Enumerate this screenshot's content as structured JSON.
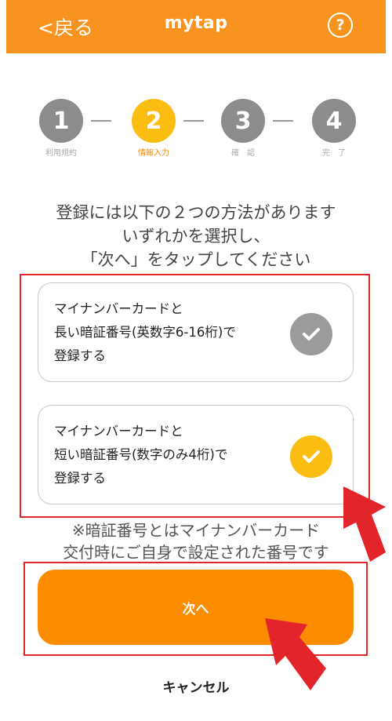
{
  "header": {
    "back_label": "<戻る",
    "title": "mytap",
    "help_label": "?"
  },
  "stepper": {
    "steps": [
      {
        "number": "1",
        "label": "利用規約"
      },
      {
        "number": "2",
        "label": "情報入力"
      },
      {
        "number": "3",
        "label": "確　認"
      },
      {
        "number": "4",
        "label": "完　了"
      }
    ],
    "active_step": 2
  },
  "instructions": {
    "line1": "登録には以下の２つの方法があります",
    "line2": "いずれかを選択し、",
    "line3": "「次へ」をタップしてください"
  },
  "options": [
    {
      "line1": "マイナンバーカードと",
      "line2": "長い暗証番号(英数字6-16桁)で",
      "line3": "登録する",
      "selected": false
    },
    {
      "line1": "マイナンバーカードと",
      "line2": "短い暗証番号(数字のみ4桁)で",
      "line3": "登録する",
      "selected": true
    }
  ],
  "note": {
    "line1": "※暗証番号とはマイナンバーカード",
    "line2": "交付時にご自身で設定された番号です"
  },
  "actions": {
    "next_label": "次へ",
    "cancel_label": "キャンセル"
  },
  "colors": {
    "brand_orange": "#f7931e",
    "active_step": "#fbbd12",
    "highlight_red": "#e2242b"
  }
}
